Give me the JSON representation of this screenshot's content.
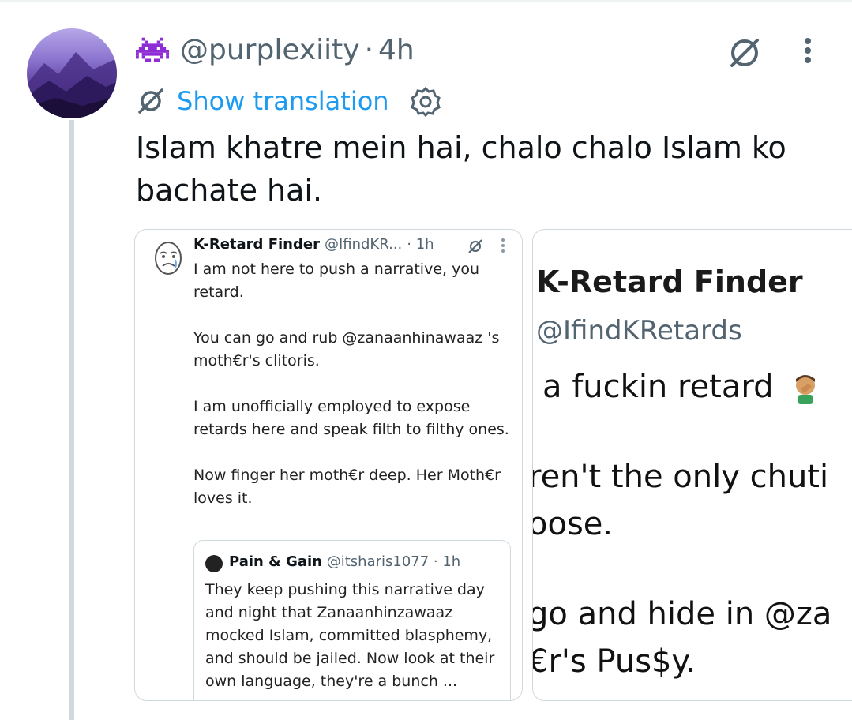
{
  "post": {
    "handle": "@purplexiity",
    "separator": "·",
    "time": "4h",
    "translate_label": "Show translation",
    "text": "Islam khatre mein hai, chalo chalo Islam ko bachate hai."
  },
  "embedded_left": {
    "name": "K-Retard Finder",
    "handle": "@IfindKR...",
    "time": "· 1h",
    "paragraphs": [
      "I am not here to push a narrative, you retard.",
      "You can go and rub @zanaanhinawaaz 's moth€r's clitoris.",
      "I am unofficially employed to expose retards here and speak filth to filthy ones.",
      "Now finger her moth€r deep. Her Moth€r loves it."
    ],
    "quote": {
      "name": "Pain & Gain",
      "handle": "@itsharis1077 · 1h",
      "text": "They keep pushing this narrative day and night that Zanaanhinzawaaz mocked Islam, committed blasphemy, and should be jailed. Now look at their own language, they're a bunch ..."
    }
  },
  "embedded_right": {
    "name": "K-Retard Finder",
    "handle": "@IfindKRetards",
    "lines": [
      "a fuckin retard",
      "ren't the only chuti",
      "oose.",
      "go and hide in @za",
      "€r's Pus$y."
    ]
  },
  "colors": {
    "accent": "#1d9bf0",
    "secondary_text": "#536471",
    "thread_line": "#cfd9de",
    "alien": "#8e2dd6"
  },
  "icons": [
    "alien-monster-icon",
    "grok-icon",
    "more-icon",
    "translate-icon",
    "settings-icon",
    "facepalm-emoji-icon"
  ]
}
